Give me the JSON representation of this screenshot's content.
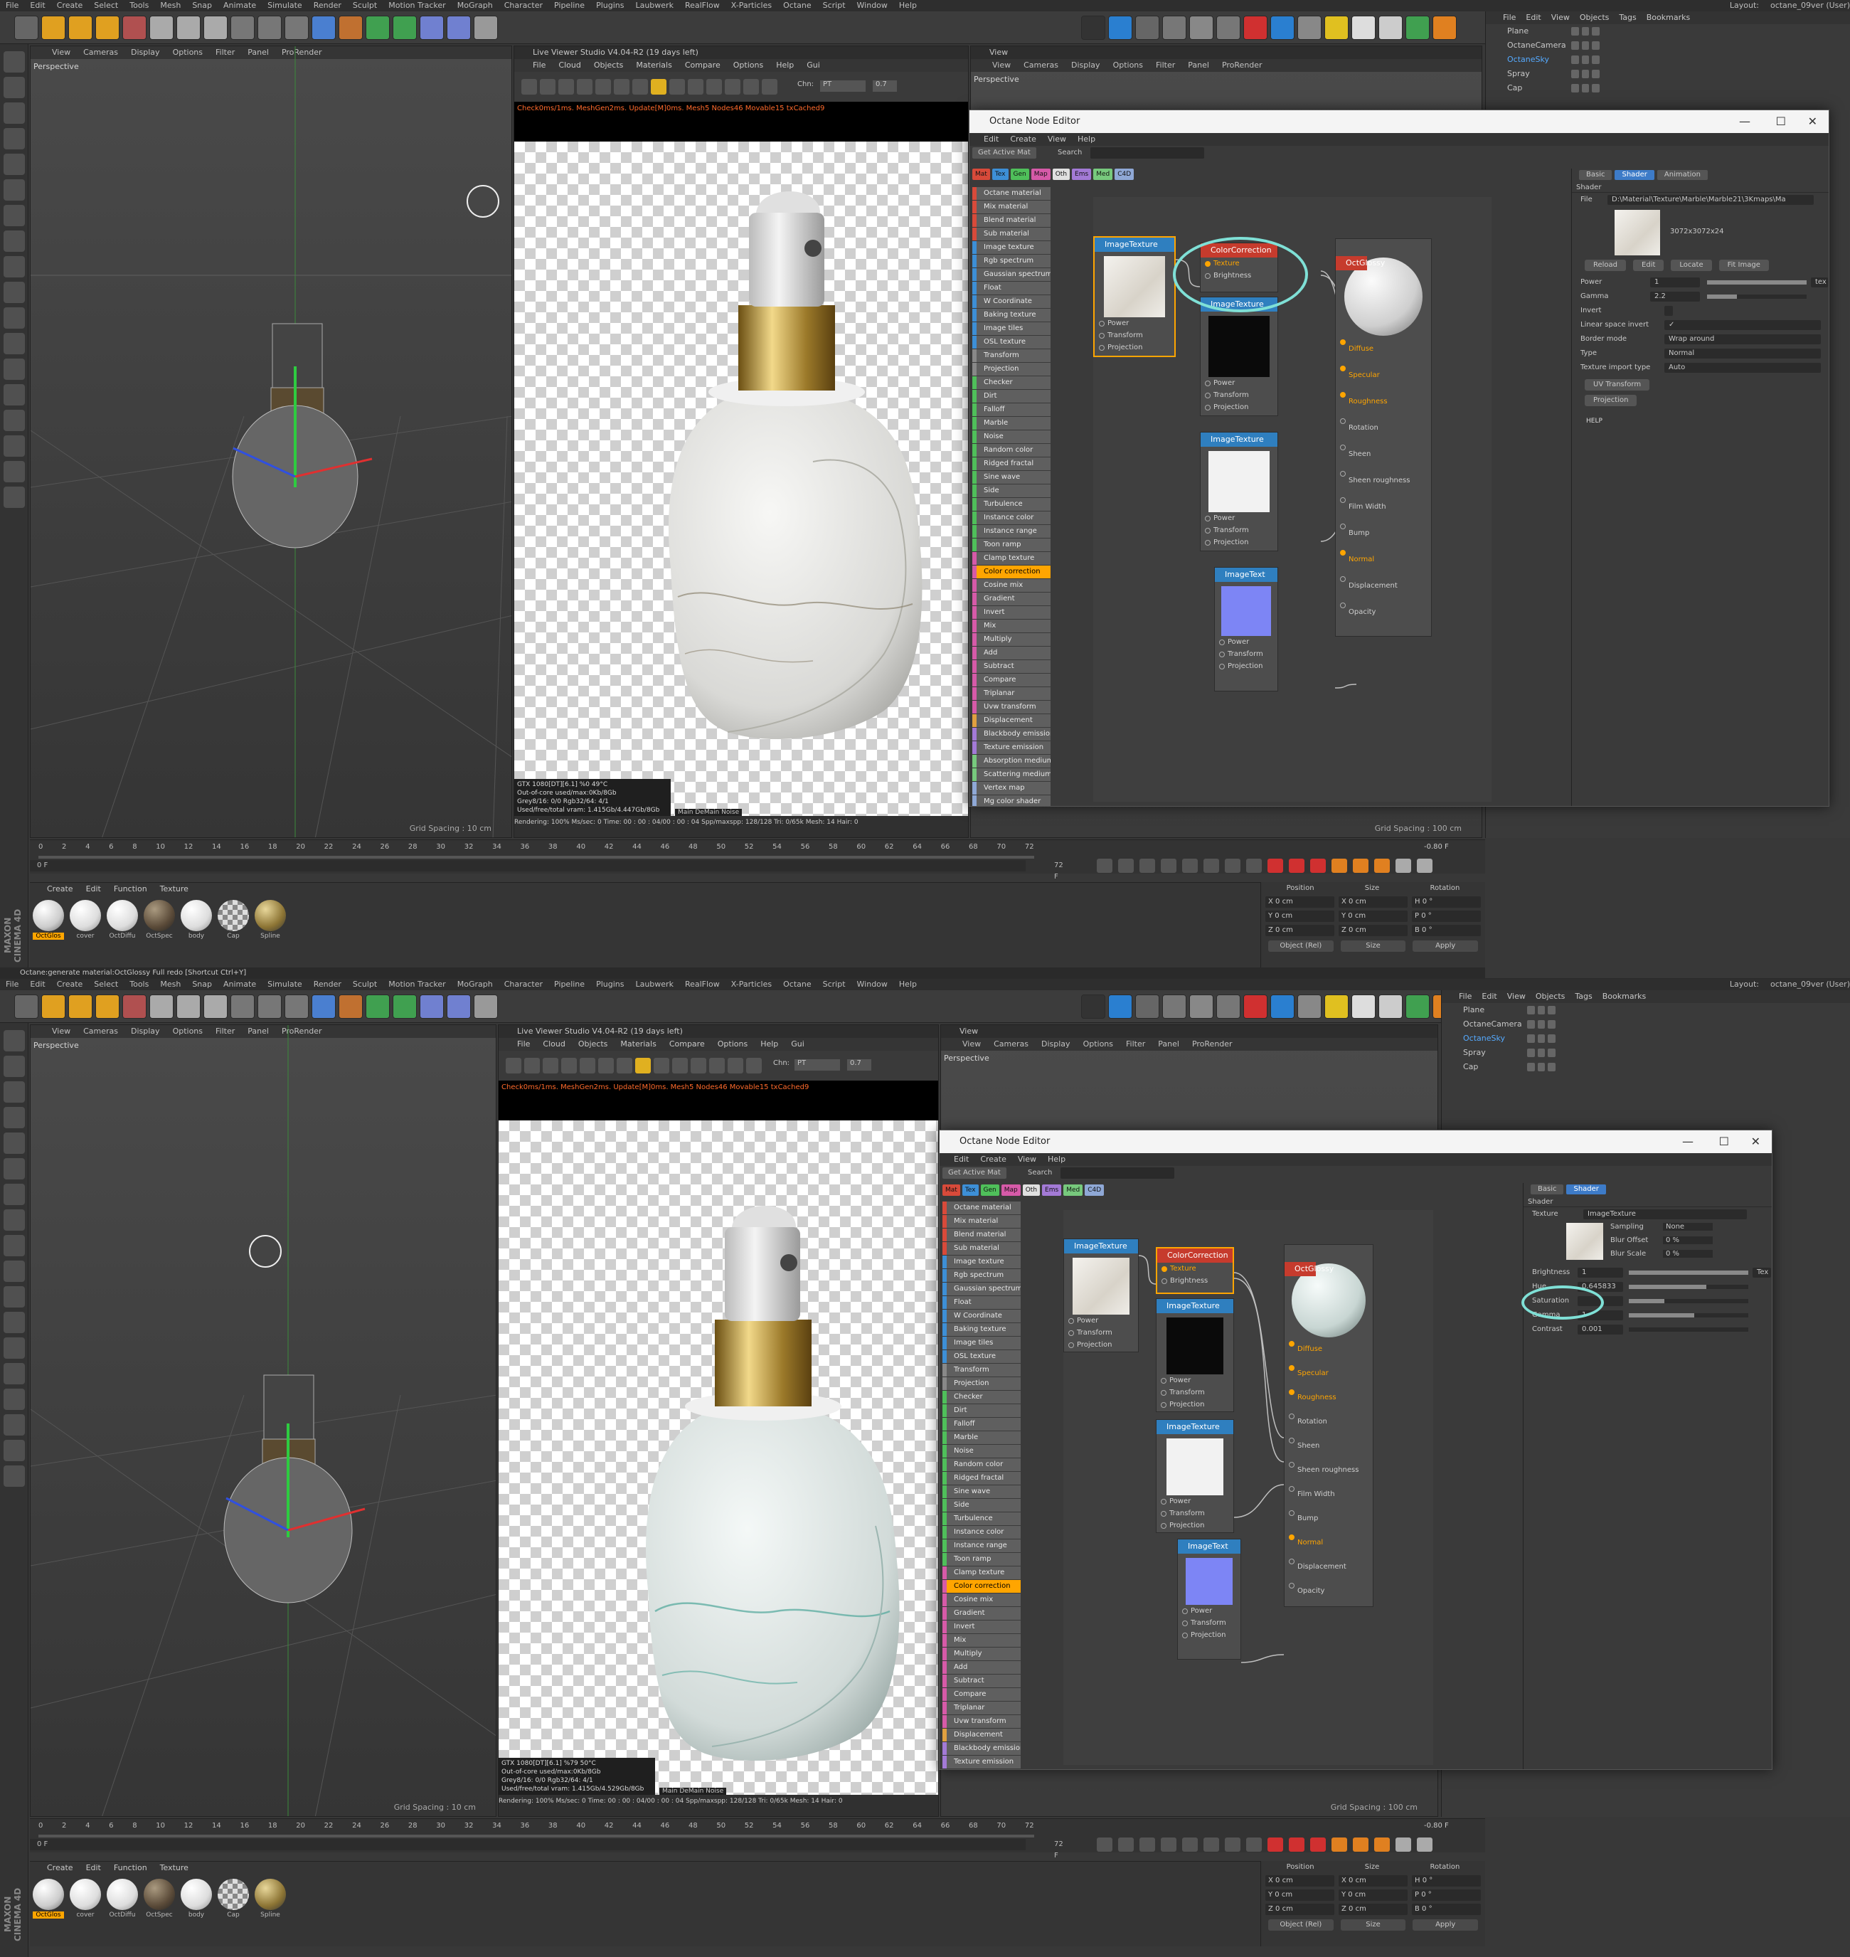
{
  "menu": [
    "File",
    "Edit",
    "Create",
    "Select",
    "Tools",
    "Mesh",
    "Snap",
    "Animate",
    "Simulate",
    "Render",
    "Sculpt",
    "Motion Tracker",
    "MoGraph",
    "Character",
    "Pipeline",
    "Plugins",
    "Laubwerk",
    "RealFlow",
    "X-Particles",
    "Octane",
    "Script",
    "Window",
    "Help"
  ],
  "layout_label": "Layout:",
  "layout_value": "octane_09ver (User)",
  "viewport": {
    "menu": [
      "View",
      "Cameras",
      "Display",
      "Options",
      "Filter",
      "Panel",
      "ProRender"
    ],
    "label": "Perspective",
    "grid_spacing": "Grid Spacing : 10 cm"
  },
  "right_viewport": {
    "title": "View",
    "label": "Perspective",
    "grid_spacing": "Grid Spacing : 100 cm"
  },
  "live_viewer": {
    "title": "Live Viewer Studio V4.04-R2 (19 days left)",
    "menu": [
      "File",
      "Cloud",
      "Objects",
      "Materials",
      "Compare",
      "Options",
      "Help",
      "Gui"
    ],
    "channel_label": "Chn:",
    "channel_value": "PT",
    "channel_num": "0.7",
    "status": "Check0ms/1ms. MeshGen2ms. Update[M]0ms. Mesh5 Nodes46 Movable15 txCached9",
    "gpu_top": "GTX 1080[DT][6.1]        %0       49°C",
    "gpu_bot": "GTX 1080[DT][6.1]        %79      50°C",
    "ooc": "Out-of-core used/max:0Kb/8Gb",
    "grey": "Grey8/16: 0/0         Rgb32/64: 4/1",
    "vram_top": "Used/free/total vram: 1.415Gb/4.447Gb/8Gb",
    "vram_bot": "Used/free/total vram: 1.415Gb/4.529Gb/8Gb",
    "tags": "Main  DeMain  Noise",
    "rendering": "Rendering: 100%  Ms/sec: 0    Time: 00 : 00 : 04/00 : 00 : 04    Spp/maxspp: 128/128    Tri: 0/65k    Mesh: 14    Hair: 0"
  },
  "objects": {
    "menu": [
      "File",
      "Edit",
      "View",
      "Objects",
      "Tags",
      "Bookmarks"
    ],
    "items": [
      "Plane",
      "OctaneCamera",
      "OctaneSky",
      "Spray",
      "Cap"
    ],
    "selected": "OctaneSky"
  },
  "timeline": {
    "ticks": [
      "0",
      "2",
      "4",
      "6",
      "8",
      "10",
      "12",
      "14",
      "16",
      "18",
      "20",
      "22",
      "24",
      "26",
      "28",
      "30",
      "32",
      "34",
      "36",
      "38",
      "40",
      "42",
      "44",
      "46",
      "48",
      "50",
      "52",
      "54",
      "56",
      "58",
      "60",
      "62",
      "64",
      "66",
      "68",
      "70",
      "72"
    ],
    "start": "0 F",
    "end": "72 F",
    "current": "-0.80 F"
  },
  "materials": {
    "menu": [
      "Create",
      "Edit",
      "Function",
      "Texture"
    ],
    "items": [
      "OctGlos",
      "cover",
      "OctDiffu",
      "OctSpec",
      "body",
      "Cap",
      "Spline"
    ],
    "selected": "OctGlos"
  },
  "coords": {
    "headers": [
      "Position",
      "Size",
      "Rotation"
    ],
    "rows": [
      [
        "X",
        "0 cm",
        "X",
        "0 cm",
        "H",
        "0 °"
      ],
      [
        "Y",
        "0 cm",
        "Y",
        "0 cm",
        "P",
        "0 °"
      ],
      [
        "Z",
        "0 cm",
        "Z",
        "0 cm",
        "B",
        "0 °"
      ]
    ],
    "mode1": "Object (Rel)",
    "mode2": "Size",
    "apply": "Apply"
  },
  "status_line": "Octane:generate material:OctGlossy    Full redo [Shortcut Ctrl+Y]",
  "maxon": "MAXON CINEMA 4D",
  "node_editor": {
    "title": "Octane Node Editor",
    "menu": [
      "Edit",
      "Create",
      "View",
      "Help"
    ],
    "get_active": "Get Active Mat",
    "search": "Search",
    "tabs": [
      "Mat",
      "Tex",
      "Gen",
      "Map",
      "Oth",
      "Ems",
      "Med",
      "C4D"
    ],
    "tab_colors": [
      "#d84a3a",
      "#3d8fd6",
      "#4fbf5a",
      "#d65aa8",
      "#e0e0e0",
      "#a37ad6",
      "#77c97d",
      "#8fa8d6"
    ],
    "list": [
      "Octane material",
      "Mix material",
      "Blend material",
      "Sub material",
      "Image texture",
      "Rgb spectrum",
      "Gaussian spectrum",
      "Float",
      "W Coordinate",
      "Baking texture",
      "Image tiles",
      "OSL texture",
      "Transform",
      "Projection",
      "Checker",
      "Dirt",
      "Falloff",
      "Marble",
      "Noise",
      "Random color",
      "Ridged fractal",
      "Sine wave",
      "Side",
      "Turbulence",
      "Instance color",
      "Instance range",
      "Toon ramp",
      "Clamp texture",
      "Color correction",
      "Cosine mix",
      "Gradient",
      "Invert",
      "Mix",
      "Multiply",
      "Add",
      "Subtract",
      "Compare",
      "Triplanar",
      "Uvw transform",
      "Displacement",
      "Blackbody emission",
      "Texture emission",
      "Absorption medium",
      "Scattering medium",
      "Vertex map",
      "Mg color shader"
    ],
    "list_colors": [
      "#d84a3a",
      "#d84a3a",
      "#d84a3a",
      "#d84a3a",
      "#3d8fd6",
      "#3d8fd6",
      "#3d8fd6",
      "#3d8fd6",
      "#3d8fd6",
      "#3d8fd6",
      "#3d8fd6",
      "#3d8fd6",
      "#888888",
      "#888888",
      "#4fbf5a",
      "#4fbf5a",
      "#4fbf5a",
      "#4fbf5a",
      "#4fbf5a",
      "#4fbf5a",
      "#4fbf5a",
      "#4fbf5a",
      "#4fbf5a",
      "#4fbf5a",
      "#4fbf5a",
      "#4fbf5a",
      "#4fbf5a",
      "#d65aa8",
      "#d65aa8",
      "#d65aa8",
      "#d65aa8",
      "#d65aa8",
      "#d65aa8",
      "#d65aa8",
      "#d65aa8",
      "#d65aa8",
      "#d65aa8",
      "#d65aa8",
      "#d65aa8",
      "#e0a040",
      "#a37ad6",
      "#a37ad6",
      "#77c97d",
      "#77c97d",
      "#8fa8d6",
      "#8fa8d6"
    ],
    "nodes": {
      "tex1": "ImageTexture",
      "cc": "ColorCorrection",
      "tex2": "ImageTexture",
      "tex3": "ImageTexture",
      "tex4": "ImageText",
      "mat": "OctGlossy"
    },
    "tex_pins": [
      "Power",
      "Transform",
      "Projection"
    ],
    "cc_pins": [
      "Texture",
      "Brightness"
    ],
    "mat_pins": [
      "Diffuse",
      "Specular",
      "Roughness",
      "Rotation",
      "Sheen",
      "Sheen roughness",
      "Film Width",
      "Bump",
      "Normal",
      "Displacement",
      "Opacity"
    ],
    "mat_pins_on": [
      "Diffuse",
      "Specular",
      "Roughness",
      "Normal"
    ]
  },
  "attr_top": {
    "tabs": [
      "Basic",
      "Shader",
      "Animation"
    ],
    "active_tab": "Shader",
    "section": "Shader",
    "file_label": "File",
    "file_value": "D:\\Material\\Texture\\Marble\\Marble21\\3Kmaps\\Ma",
    "resolution": "3072x3072x24",
    "buttons": [
      "Reload",
      "Edit",
      "Locate",
      "Fit Image"
    ],
    "rows": [
      {
        "label": "Power",
        "value": "1"
      },
      {
        "label": "Gamma",
        "value": "2.2"
      },
      {
        "label": "Invert",
        "value": ""
      },
      {
        "label": "Linear space invert",
        "value": "✓"
      },
      {
        "label": "Border mode",
        "value": "Wrap around"
      },
      {
        "label": "Type",
        "value": "Normal"
      },
      {
        "label": "Texture import type",
        "value": "Auto"
      }
    ],
    "tex_btn": "tex",
    "uv": "UV Transform",
    "proj": "Projection",
    "help": "HELP"
  },
  "attr_bot": {
    "tabs": [
      "Basic",
      "Shader"
    ],
    "active_tab": "Shader",
    "section": "Shader",
    "texture_label": "Texture",
    "texture_value": "ImageTexture",
    "sampling_label": "Sampling",
    "sampling_value": "None",
    "blur_offset_label": "Blur Offset",
    "blur_offset_value": "0 %",
    "blur_scale_label": "Blur Scale",
    "blur_scale_value": "0 %",
    "rows": [
      {
        "label": "Brightness",
        "value": "1"
      },
      {
        "label": "Hue",
        "value": "0.645833"
      },
      {
        "label": "Saturation",
        "value": ""
      },
      {
        "label": "Gamma",
        "value": "1"
      },
      {
        "label": "Contrast",
        "value": "0.001"
      }
    ],
    "slider_levels": [
      1.0,
      0.65,
      0.3,
      0.55,
      0.0
    ],
    "tex_btn": "Tex"
  }
}
